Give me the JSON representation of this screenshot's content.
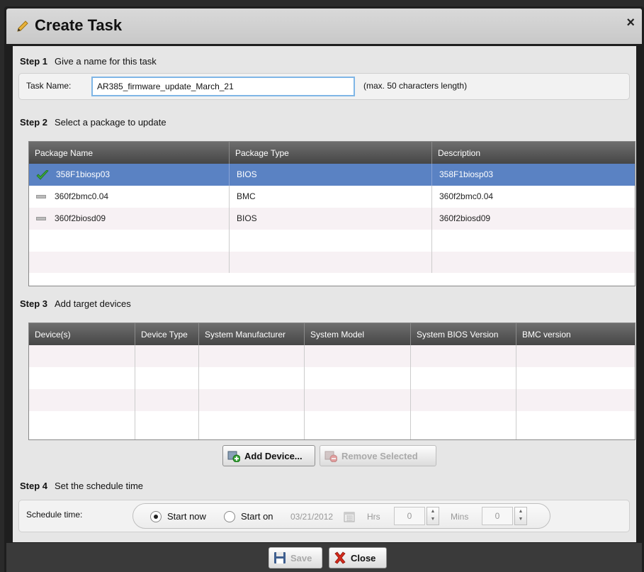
{
  "dialog": {
    "title": "Create Task",
    "close_glyph": "×"
  },
  "step1": {
    "num": "Step 1",
    "text": "Give a name for this task",
    "field_label": "Task Name:",
    "task_name_value": "AR385_firmware_update_March_21",
    "hint": "(max. 50 characters length)"
  },
  "step2": {
    "num": "Step 2",
    "text": "Select a package to update",
    "columns": [
      "Package Name",
      "Package Type",
      "Description"
    ],
    "rows": [
      {
        "name": "358F1biosp03",
        "type": "BIOS",
        "description": "358F1biosp03",
        "selected": true
      },
      {
        "name": "360f2bmc0.04",
        "type": "BMC",
        "description": "360f2bmc0.04",
        "selected": false
      },
      {
        "name": "360f2biosd09",
        "type": "BIOS",
        "description": "360f2biosd09",
        "selected": false
      }
    ]
  },
  "step3": {
    "num": "Step 3",
    "text": "Add target devices",
    "columns": [
      "Device(s)",
      "Device Type",
      "System Manufacturer",
      "System Model",
      "System BIOS Version",
      "BMC version"
    ],
    "add_label": "Add Device...",
    "remove_label": "Remove Selected"
  },
  "step4": {
    "num": "Step 4",
    "text": "Set the schedule time",
    "field_label": "Schedule time:",
    "opt_now": "Start now",
    "opt_on": "Start on",
    "date_value": "03/21/2012",
    "hrs_label": "Hrs",
    "hrs_value": "0",
    "mins_label": "Mins",
    "mins_value": "0"
  },
  "footer": {
    "save_label": "Save",
    "close_label": "Close"
  },
  "colors": {
    "selected_row": "#5a82c3",
    "check_green": "#3aa63a",
    "header_dark": "#4e4e4e"
  }
}
